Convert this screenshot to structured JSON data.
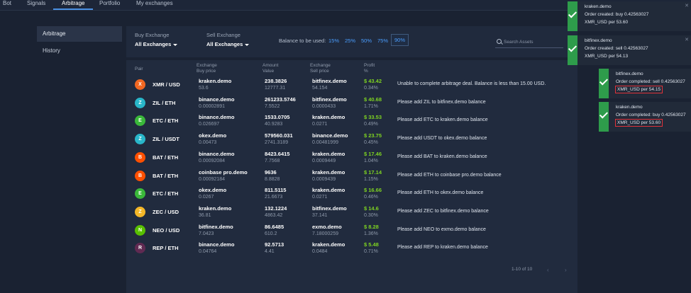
{
  "nav": {
    "tabs": [
      {
        "label": "Bot"
      },
      {
        "label": "Signals"
      },
      {
        "label": "Arbitrage"
      },
      {
        "label": "Portfolio"
      },
      {
        "label": "My exchanges"
      }
    ],
    "active": "Arbitrage"
  },
  "sidebar": {
    "items": [
      {
        "label": "Arbitrage"
      },
      {
        "label": "History"
      }
    ]
  },
  "filters": {
    "buy_label": "Buy Exchange",
    "buy_value": "All Exchanges",
    "sell_label": "Sell Exchange",
    "sell_value": "All Exchanges",
    "balance_label": "Balance to be used:",
    "percents": [
      "15%",
      "25%",
      "50%",
      "75%",
      "90%"
    ],
    "selected_percent": "90%",
    "search_placeholder": "Search Assets"
  },
  "table": {
    "headers": {
      "pair": "Pair",
      "buy_1": "Exchange",
      "buy_2": "Buy price",
      "amount_1": "Amount",
      "amount_2": "Value",
      "sell_1": "Exchange",
      "sell_2": "Sell price",
      "profit_1": "Profit",
      "profit_2": "%"
    },
    "rows": [
      {
        "coin": "XMR",
        "coin_color": "#f26822",
        "pair": "XMR / USD",
        "buy_exchange": "kraken.demo",
        "buy_price": "53.6",
        "amount": "238.3826",
        "value": "12777.31",
        "sell_exchange": "bitfinex.demo",
        "sell_price": "54.154",
        "profit": "$ 43.42",
        "profit_pct": "0.34%",
        "message": "Unable to complete arbitrage deal. Balance is less than 15.00 USD."
      },
      {
        "coin": "ZIL",
        "coin_color": "#29b6c9",
        "pair": "ZIL / ETH",
        "buy_exchange": "binance.demo",
        "buy_price": "0.00002891",
        "amount": "261233.5746",
        "value": "7.5522",
        "sell_exchange": "bitfinex.demo",
        "sell_price": "0.0000433",
        "profit": "$ 40.68",
        "profit_pct": "1.71%",
        "message": "Please add ZIL to bitfinex.demo balance"
      },
      {
        "coin": "ETC",
        "coin_color": "#3ab83a",
        "pair": "ETC / ETH",
        "buy_exchange": "binance.demo",
        "buy_price": "0.026697",
        "amount": "1533.0705",
        "value": "40.9283",
        "sell_exchange": "kraken.demo",
        "sell_price": "0.0271",
        "profit": "$ 33.53",
        "profit_pct": "0.49%",
        "message": "Please add ETC to kraken.demo balance"
      },
      {
        "coin": "ZIL",
        "coin_color": "#29b6c9",
        "pair": "ZIL / USDT",
        "buy_exchange": "okex.demo",
        "buy_price": "0.00473",
        "amount": "579560.031",
        "value": "2741.3189",
        "sell_exchange": "binance.demo",
        "sell_price": "0.00481999",
        "profit": "$ 23.75",
        "profit_pct": "0.45%",
        "message": "Please add USDT to okex.demo balance"
      },
      {
        "coin": "BAT",
        "coin_color": "#ff5000",
        "pair": "BAT / ETH",
        "buy_exchange": "binance.demo",
        "buy_price": "0.00092084",
        "amount": "8423.6415",
        "value": "7.7568",
        "sell_exchange": "kraken.demo",
        "sell_price": "0.0009449",
        "profit": "$ 17.46",
        "profit_pct": "1.04%",
        "message": "Please add BAT to kraken.demo balance"
      },
      {
        "coin": "BAT",
        "coin_color": "#ff5000",
        "pair": "BAT / ETH",
        "buy_exchange": "coinbase pro.demo",
        "buy_price": "0.00092184",
        "amount": "9636",
        "value": "8.8828",
        "sell_exchange": "kraken.demo",
        "sell_price": "0.0009439",
        "profit": "$ 17.14",
        "profit_pct": "1.15%",
        "message": "Please add ETH to coinbase pro.demo balance"
      },
      {
        "coin": "ETC",
        "coin_color": "#3ab83a",
        "pair": "ETC / ETH",
        "buy_exchange": "okex.demo",
        "buy_price": "0.0267",
        "amount": "811.5115",
        "value": "21.6673",
        "sell_exchange": "kraken.demo",
        "sell_price": "0.0271",
        "profit": "$ 16.66",
        "profit_pct": "0.46%",
        "message": "Please add ETH to okex.demo balance"
      },
      {
        "coin": "ZEC",
        "coin_color": "#f4b728",
        "pair": "ZEC / USD",
        "buy_exchange": "kraken.demo",
        "buy_price": "36.81",
        "amount": "132.1224",
        "value": "4863.42",
        "sell_exchange": "bitfinex.demo",
        "sell_price": "37.141",
        "profit": "$ 14.6",
        "profit_pct": "0.30%",
        "message": "Please add ZEC to bitfinex.demo balance"
      },
      {
        "coin": "NEO",
        "coin_color": "#58bf00",
        "pair": "NEO / USD",
        "buy_exchange": "bitfinex.demo",
        "buy_price": "7.0423",
        "amount": "86.6485",
        "value": "610.2",
        "sell_exchange": "exmo.demo",
        "sell_price": "7.18000259",
        "profit": "$ 8.28",
        "profit_pct": "1.36%",
        "message": "Please add NEO to exmo.demo balance"
      },
      {
        "coin": "REP",
        "coin_color": "#602a52",
        "pair": "REP / ETH",
        "buy_exchange": "binance.demo",
        "buy_price": "0.04764",
        "amount": "92.5713",
        "value": "4.41",
        "sell_exchange": "kraken.demo",
        "sell_price": "0.0484",
        "profit": "$ 5.48",
        "profit_pct": "0.71%",
        "message": "Please add REP to kraken.demo balance"
      }
    ],
    "pagination": "1-10 of 10"
  },
  "notifications": [
    {
      "exchange": "kraken.demo",
      "line2": "Order created: buy 0.42563027",
      "line3": "XMR_USD per 53.60",
      "boxed": false
    },
    {
      "exchange": "bitfinex.demo",
      "line2": "Order created: sell 0.42563027",
      "line3": "XMR_USD per 54.13",
      "boxed": false
    },
    {
      "exchange": "bitfinex.demo",
      "line2": "Order completed: sell 0.42563027",
      "line3": "XMR_USD per 54.15",
      "boxed": true
    },
    {
      "exchange": "kraken.demo",
      "line2": "Order completed: buy 0.42563027",
      "line3": "XMR_USD per 53.60",
      "boxed": true
    }
  ],
  "colors": {
    "profit_green": "#7ed321",
    "link_blue": "#4a9eff",
    "success_green": "#2e9c4b",
    "highlight_red": "#e0323a"
  }
}
